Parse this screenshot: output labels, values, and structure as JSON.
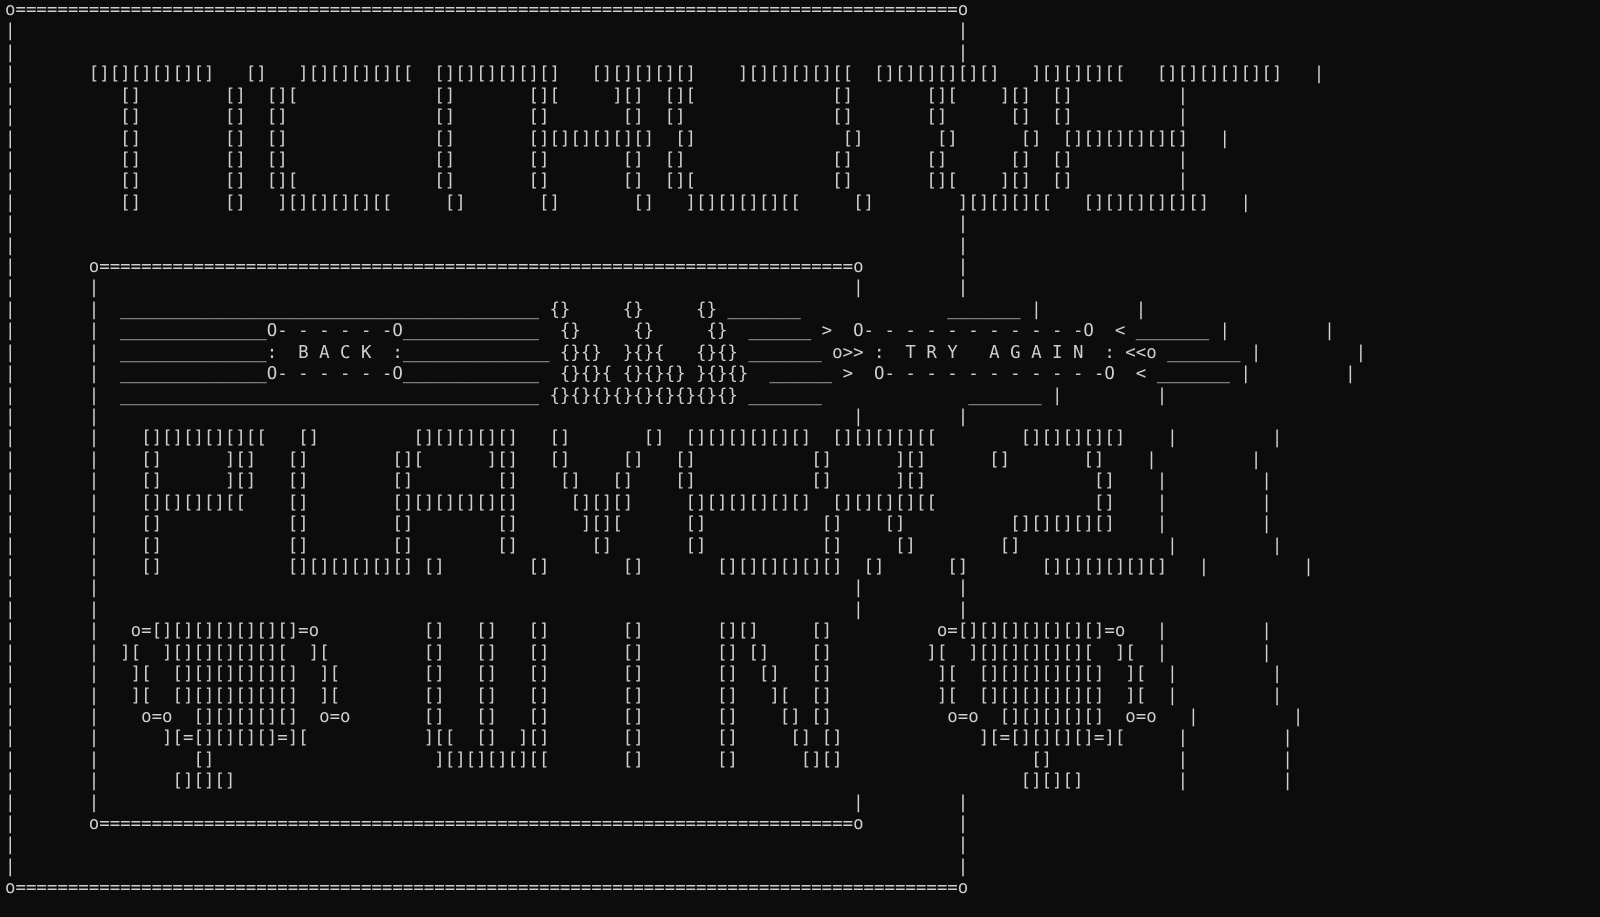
{
  "screen": {
    "lines": [
      "o==========================================================================================o",
      "|                                                                                          |",
      "|                                                                                          |",
      "|       [][][][][][]   []   ][][][][][[  [][][][][][]   [][][][][]    ][][][][][[  [][][][][][]   ][][][][[   [][][][][][]   |",
      "|          []        []  [][             []       [][     ][]  [][             []       [][    ][]  []          |",
      "|          []        []  []              []       []       []  []              []       []      []  []          |",
      "|          []        []  []              []       [][][][][][]  []              []       []      []  [][][][][][]   |",
      "|          []        []  []              []       []       []  []              []       []      []  []          |",
      "|          []        []  [][             []       []       []  [][             []       [][    ][]  []          |",
      "|          []        []   ][][][][][[     []       []       []   ][][][][][[     []        ][][][][[   [][][][][][]   |",
      "|                                                                                          |",
      "|                                                                                          |",
      "|       o========================================================================o         |",
      "|       |                                                                        |         |",
      "|       |  ________________________________________ {}     {}     {} _______              _______ |         |",
      "|       |  ______________O- - - - - -O_____________  {}     {}     {}  ______ >  O- - - - - - - - - - -O  < _______ |         |",
      "|       |  ______________:  B A C K  :______________ {}{}  }{}{   {}{} _______ o>> :  T R Y   A G A I N  : <<o _______ |         |",
      "|       |  ______________O- - - - - -O_____________  {}{}{ {}{}{} }{}{}  ______ >  O- - - - - - - - - - -O  < _______ |         |",
      "|       |  ________________________________________ {}{}{}{}{}{}{}{}{} _______              _______ |         |",
      "|       |                                                                        |         |",
      "|       |    [][][][][][[   []         [][][][][]   []       []  [][][][][][]  [][][][][[        [][][][][]    |         |",
      "|       |    []      ][]   []        [][      ][]   []     []   []           []      ][]      []       []    |         |",
      "|       |    []      ][]   []        []        []    []   []    []           []      ][]                []    |         |",
      "|       |    [][][][][[    []        [][][][][][]     [][][]     [][][][][][]  [][][][][[               []    |         |",
      "|       |    []            []        []        []      ][][      []           []    []          [][][][][]    |         |",
      "|       |    []            []        []        []       []       []           []     []        []              |         |",
      "|       |    []            [][][][][][] []        []       []       [][][][][][]  []      []       [][][][][][]   |         |",
      "|       |                                                                        |         |",
      "|       |                                                                        |         |",
      "|       |   o=[][][][][][][]=o          []   []   []       []       [][]     []          o=[][][][][][][]=o   |         |",
      "|       |  ][  ][][][][][][  ][         []   []   []       []       [] []    []         ][  ][][][][][][  ][  |         |",
      "|       |   ][  [][][][][][]  ][        []   []   []       []       []  []   []          ][  [][][][][][]  ][  |         |",
      "|       |   ][  [][][][][][]  ][        []   []   []       []       []   ][  []          ][  [][][][][][]  ][  |         |",
      "|       |    o=o  [][][][][]  o=o       []   []   []       []       []    [] []           o=o  [][][][][]  o=o   |         |",
      "|       |      ][=[][][][]=][           ][[  []  ][]       []       []     [] []             ][=[][][][]=][     |         |",
      "|       |         []                     ][][][][][[       []       []      [][]                  []            |         |",
      "|       |       [][][]                                                                           [][][]         |         |",
      "|       |                                                                        |         |",
      "|       o========================================================================o         |",
      "|                                                                                          |",
      "|                                                                                          |",
      "o==========================================================================================o"
    ]
  }
}
